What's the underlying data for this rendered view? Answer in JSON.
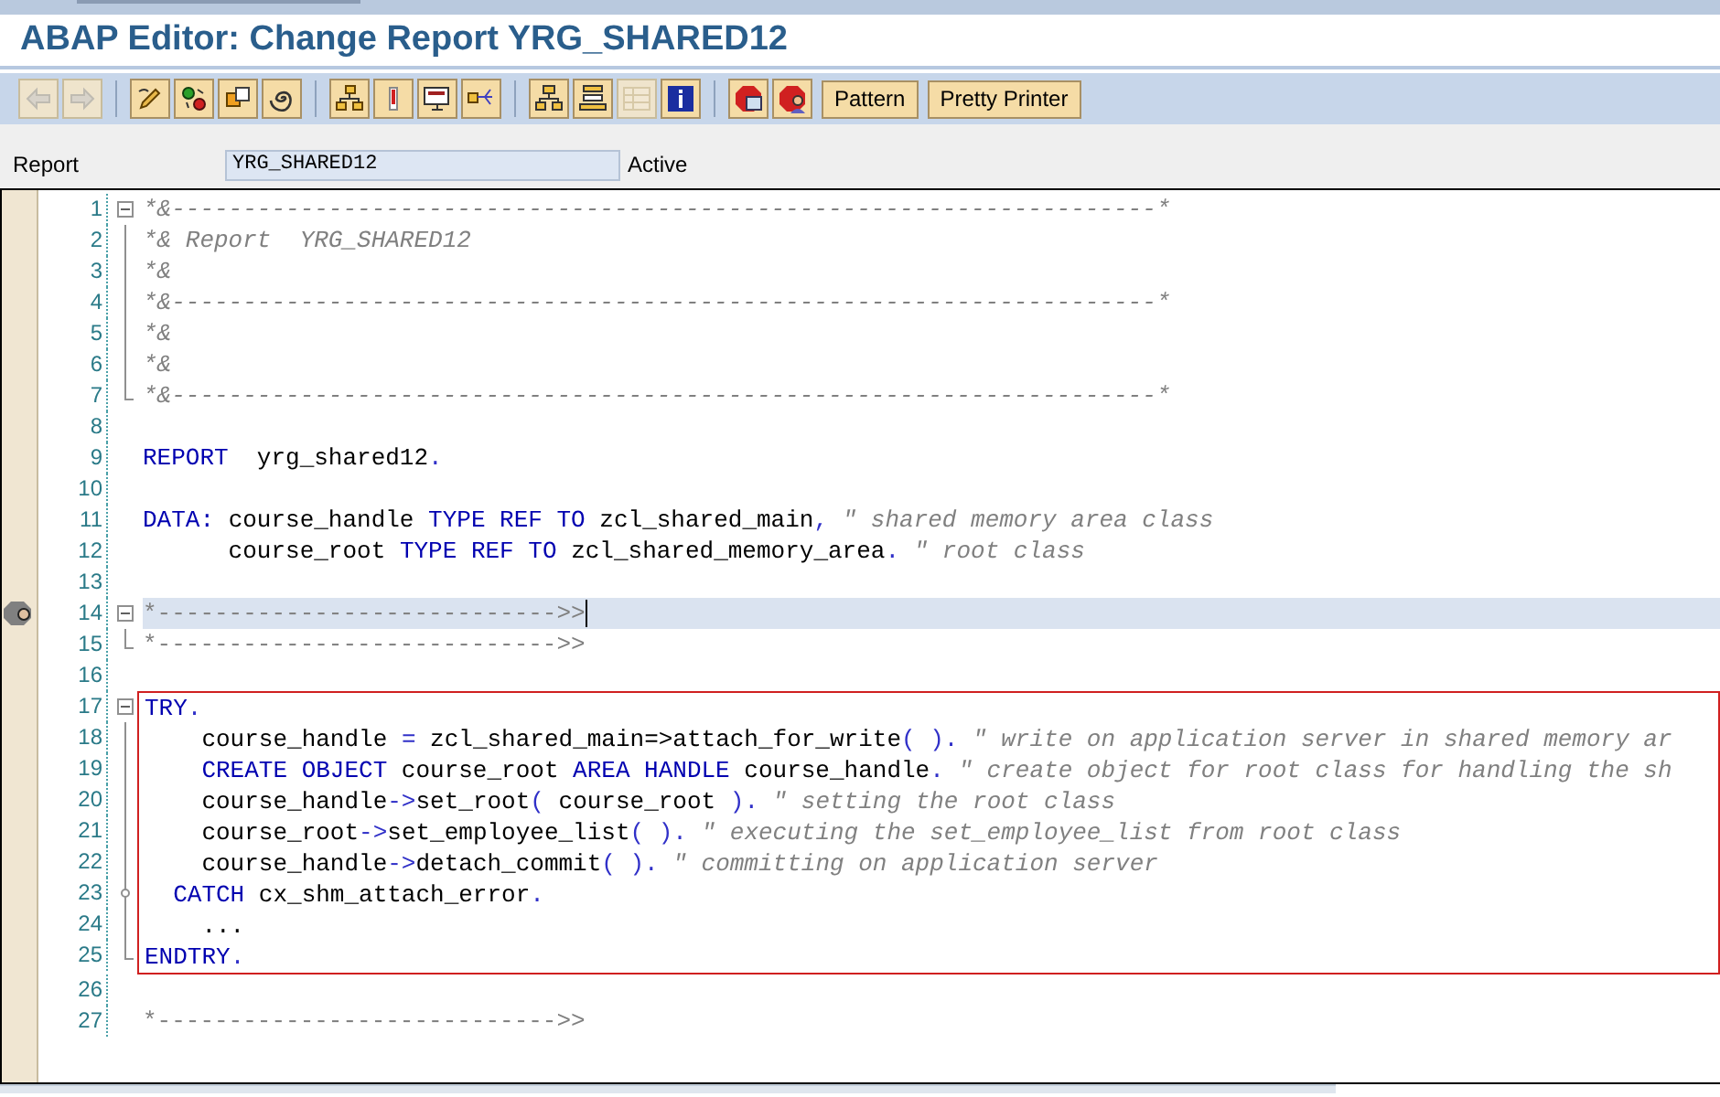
{
  "window": {
    "title": "ABAP Editor: Change Report YRG_SHARED12"
  },
  "toolbar": [
    {
      "kind": "icon",
      "disabled": true
    },
    {
      "kind": "icon",
      "disabled": true
    },
    {
      "kind": "separator"
    },
    {
      "kind": "icon",
      "disabled": false
    },
    {
      "kind": "icon",
      "disabled": false
    },
    {
      "kind": "icon",
      "disabled": false
    },
    {
      "kind": "icon",
      "disabled": false
    },
    {
      "kind": "separator"
    },
    {
      "kind": "icon",
      "disabled": false
    },
    {
      "kind": "icon",
      "disabled": false
    },
    {
      "kind": "icon",
      "disabled": false
    },
    {
      "kind": "icon",
      "disabled": false
    },
    {
      "kind": "separator"
    },
    {
      "kind": "icon",
      "disabled": false
    },
    {
      "kind": "icon",
      "disabled": false
    },
    {
      "kind": "icon",
      "disabled": true
    },
    {
      "kind": "icon",
      "disabled": false
    },
    {
      "kind": "separator"
    },
    {
      "kind": "icon",
      "disabled": false
    },
    {
      "kind": "icon",
      "disabled": false
    },
    {
      "kind": "text",
      "label": "Pattern"
    },
    {
      "kind": "text",
      "label": "Pretty Printer"
    }
  ],
  "report": {
    "label": "Report",
    "value": "YRG_SHARED12",
    "status": "Active"
  },
  "editor": {
    "blocks": [
      {
        "boxed": false,
        "lines": [
          {
            "number": "1",
            "kind": "open",
            "selected": false,
            "tokens": [
              {
                "kind": "comment",
                "text": "*&---------------------------------------------------------------------*"
              }
            ]
          },
          {
            "number": "2",
            "kind": "guide",
            "selected": false,
            "tokens": [
              {
                "kind": "comment",
                "text": "*& Report  YRG_SHARED12"
              }
            ]
          },
          {
            "number": "3",
            "kind": "guide",
            "selected": false,
            "tokens": [
              {
                "kind": "comment",
                "text": "*&"
              }
            ]
          },
          {
            "number": "4",
            "kind": "guide",
            "selected": false,
            "tokens": [
              {
                "kind": "comment",
                "text": "*&---------------------------------------------------------------------*"
              }
            ]
          },
          {
            "number": "5",
            "kind": "guide",
            "selected": false,
            "tokens": [
              {
                "kind": "comment",
                "text": "*&"
              }
            ]
          },
          {
            "number": "6",
            "kind": "guide",
            "selected": false,
            "tokens": [
              {
                "kind": "comment",
                "text": "*&"
              }
            ]
          },
          {
            "number": "7",
            "kind": "end",
            "selected": false,
            "tokens": [
              {
                "kind": "comment",
                "text": "*&---------------------------------------------------------------------*"
              }
            ]
          },
          {
            "number": "8",
            "kind": "plain",
            "selected": false
          },
          {
            "number": "9",
            "kind": "plain",
            "selected": false,
            "tokens": [
              {
                "kind": "keyword",
                "text": "REPORT"
              },
              {
                "kind": "plain",
                "text": "  yrg_shared12"
              },
              {
                "kind": "operator",
                "text": "."
              }
            ]
          },
          {
            "number": "10",
            "kind": "plain",
            "selected": false
          },
          {
            "number": "11",
            "kind": "plain",
            "selected": false,
            "tokens": [
              {
                "kind": "keyword",
                "text": "DATA:"
              },
              {
                "kind": "plain",
                "text": " course_handle "
              },
              {
                "kind": "keyword",
                "text": "TYPE REF TO"
              },
              {
                "kind": "plain",
                "text": " zcl_shared_main"
              },
              {
                "kind": "operator",
                "text": ","
              },
              {
                "kind": "comment",
                "text": " \" shared memory area class"
              }
            ]
          },
          {
            "number": "12",
            "kind": "plain",
            "selected": false,
            "tokens": [
              {
                "kind": "plain",
                "text": "      course_root "
              },
              {
                "kind": "keyword",
                "text": "TYPE REF TO"
              },
              {
                "kind": "plain",
                "text": " zcl_shared_memory_area"
              },
              {
                "kind": "operator",
                "text": "."
              },
              {
                "kind": "comment",
                "text": " \" root class"
              }
            ]
          },
          {
            "number": "13",
            "kind": "plain",
            "selected": false
          },
          {
            "number": "14",
            "kind": "open",
            "selected": true,
            "gutter_icon": true,
            "tokens": [
              {
                "kind": "separator",
                "text": "*---------------------------->>"
              }
            ]
          },
          {
            "number": "15",
            "kind": "end",
            "selected": false,
            "tokens": [
              {
                "kind": "separator",
                "text": "*---------------------------->>"
              }
            ]
          },
          {
            "number": "16",
            "kind": "plain",
            "selected": false
          }
        ]
      },
      {
        "boxed": true,
        "lines": [
          {
            "number": "17",
            "kind": "open",
            "selected": false,
            "tokens": [
              {
                "kind": "keyword",
                "text": "TRY"
              },
              {
                "kind": "operator",
                "text": "."
              }
            ]
          },
          {
            "number": "18",
            "kind": "guide",
            "selected": false,
            "tokens": [
              {
                "kind": "plain",
                "text": "    course_handle "
              },
              {
                "kind": "operator",
                "text": "="
              },
              {
                "kind": "plain",
                "text": " zcl_shared_main=>attach_for_write"
              },
              {
                "kind": "operator",
                "text": "( )."
              },
              {
                "kind": "comment",
                "text": " \" write on application server in shared memory ar"
              }
            ]
          },
          {
            "number": "19",
            "kind": "guide",
            "selected": false,
            "tokens": [
              {
                "kind": "keyword",
                "text": "    CREATE OBJECT"
              },
              {
                "kind": "plain",
                "text": " course_root "
              },
              {
                "kind": "keyword",
                "text": "AREA HANDLE"
              },
              {
                "kind": "plain",
                "text": " course_handle"
              },
              {
                "kind": "operator",
                "text": "."
              },
              {
                "kind": "comment",
                "text": " \" create object for root class for handling the sh"
              }
            ]
          },
          {
            "number": "20",
            "kind": "guide",
            "selected": false,
            "tokens": [
              {
                "kind": "plain",
                "text": "    course_handle"
              },
              {
                "kind": "operator",
                "text": "->"
              },
              {
                "kind": "plain",
                "text": "set_root"
              },
              {
                "kind": "operator",
                "text": "("
              },
              {
                "kind": "plain",
                "text": " course_root "
              },
              {
                "kind": "operator",
                "text": ")."
              },
              {
                "kind": "comment",
                "text": " \" setting the root class"
              }
            ]
          },
          {
            "number": "21",
            "kind": "guide",
            "selected": false,
            "tokens": [
              {
                "kind": "plain",
                "text": "    course_root"
              },
              {
                "kind": "operator",
                "text": "->"
              },
              {
                "kind": "plain",
                "text": "set_employee_list"
              },
              {
                "kind": "operator",
                "text": "( )."
              },
              {
                "kind": "comment",
                "text": " \" executing the set_employee_list from root class"
              }
            ]
          },
          {
            "number": "22",
            "kind": "guide",
            "selected": false,
            "tokens": [
              {
                "kind": "plain",
                "text": "    course_handle"
              },
              {
                "kind": "operator",
                "text": "->"
              },
              {
                "kind": "plain",
                "text": "detach_commit"
              },
              {
                "kind": "operator",
                "text": "( )."
              },
              {
                "kind": "comment",
                "text": " \" committing on application server"
              }
            ]
          },
          {
            "number": "23",
            "kind": "node",
            "selected": false,
            "tokens": [
              {
                "kind": "keyword",
                "text": "  CATCH"
              },
              {
                "kind": "plain",
                "text": " cx_shm_attach_error"
              },
              {
                "kind": "operator",
                "text": "."
              }
            ]
          },
          {
            "number": "24",
            "kind": "guide",
            "selected": false,
            "tokens": [
              {
                "kind": "plain",
                "text": "    ..."
              }
            ]
          },
          {
            "number": "25",
            "kind": "end",
            "selected": false,
            "tokens": [
              {
                "kind": "keyword",
                "text": "ENDTRY"
              },
              {
                "kind": "operator",
                "text": "."
              }
            ]
          }
        ]
      },
      {
        "boxed": false,
        "lines": [
          {
            "number": "26",
            "kind": "plain",
            "selected": false
          },
          {
            "number": "27",
            "kind": "plain",
            "selected": false,
            "tokens": [
              {
                "kind": "separator",
                "text": "*---------------------------->>"
              }
            ]
          }
        ]
      }
    ]
  }
}
